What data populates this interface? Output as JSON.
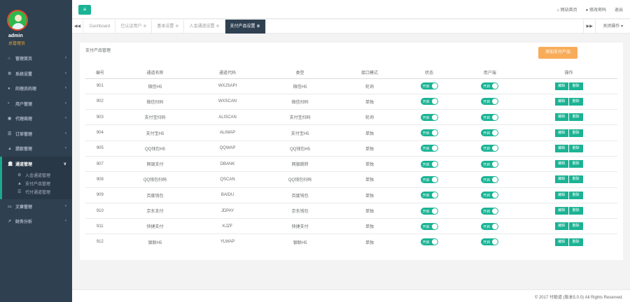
{
  "profile": {
    "name": "admin",
    "role": "总管理员"
  },
  "sidebar": {
    "items": [
      {
        "label": "管理首页",
        "icon": "home-icon"
      },
      {
        "label": "系统设置",
        "icon": "gear-icon"
      },
      {
        "label": "的理员的理",
        "icon": "user-icon"
      },
      {
        "label": "用户管理",
        "icon": "users-icon"
      },
      {
        "label": "代理商理",
        "icon": "eye-icon"
      },
      {
        "label": "订单管理",
        "icon": "list-icon"
      },
      {
        "label": "提款管理",
        "icon": "lock-icon"
      }
    ],
    "active": {
      "label": "通道管理",
      "icon": "bank-icon",
      "subs": [
        {
          "label": "入金通道管理",
          "icon": "gear-icon"
        },
        {
          "label": "支付产品管理",
          "icon": "warning-icon"
        },
        {
          "label": "代付通道管理",
          "icon": "list-icon"
        }
      ]
    },
    "bottom": [
      {
        "label": "文章管理",
        "icon": "book-icon"
      },
      {
        "label": "财务分析",
        "icon": "chart-icon"
      }
    ]
  },
  "topbar": {
    "menu_icon": "≡",
    "site_home": "网站首页",
    "change_pwd": "修改密码",
    "logout": "退出"
  },
  "tabbar": {
    "tabs": [
      {
        "label": "Dashboard",
        "closable": false
      },
      {
        "label": "已认证用户",
        "closable": true
      },
      {
        "label": "基本设置",
        "closable": true
      },
      {
        "label": "入金通道设置",
        "closable": true
      },
      {
        "label": "支付产品设置",
        "closable": true
      }
    ],
    "close_ops": "关闭操作"
  },
  "panel": {
    "title": "支付产品管理",
    "add_label": "添加支付产品"
  },
  "table": {
    "headers": [
      "编号",
      "通道名称",
      "通道代码",
      "类型",
      "接口模式",
      "状态",
      "用户端",
      "操作"
    ],
    "rows": [
      {
        "id": "901",
        "name": "微信H5",
        "code": "WXJSAPI",
        "type": "微信H5",
        "mode": "轮询"
      },
      {
        "id": "902",
        "name": "微信扫码",
        "code": "WXSCAN",
        "type": "微信扫码",
        "mode": "单独"
      },
      {
        "id": "903",
        "name": "支付宝扫码",
        "code": "ALISCAN",
        "type": "支付宝扫码",
        "mode": "轮询"
      },
      {
        "id": "904",
        "name": "支付宝H5",
        "code": "ALIWAP",
        "type": "支付宝H5",
        "mode": "单独"
      },
      {
        "id": "905",
        "name": "QQ钱包H5",
        "code": "QQWAP",
        "type": "QQ钱包H5",
        "mode": "单独"
      },
      {
        "id": "907",
        "name": "网银支付",
        "code": "DBANK",
        "type": "网银跳转",
        "mode": "单独"
      },
      {
        "id": "908",
        "name": "QQ钱包扫码",
        "code": "QSCAN",
        "type": "QQ钱包扫码",
        "mode": "单独"
      },
      {
        "id": "909",
        "name": "百度钱包",
        "code": "BAIDU",
        "type": "百度钱包",
        "mode": "单独"
      },
      {
        "id": "910",
        "name": "京东支付",
        "code": "JDPAY",
        "type": "京东钱包",
        "mode": "单独"
      },
      {
        "id": "911",
        "name": "快捷支付",
        "code": "KJZF",
        "type": "快捷支付",
        "mode": "单独"
      },
      {
        "id": "912",
        "name": "银联H5",
        "code": "YLWAP",
        "type": "银联H5",
        "mode": "单独"
      }
    ],
    "switch_label": "开启",
    "edit_label": "编辑",
    "delete_label": "删除"
  },
  "footer": {
    "copyright": "© 2017 付聪道 (版本5.0.0) All Rights Reserved."
  }
}
